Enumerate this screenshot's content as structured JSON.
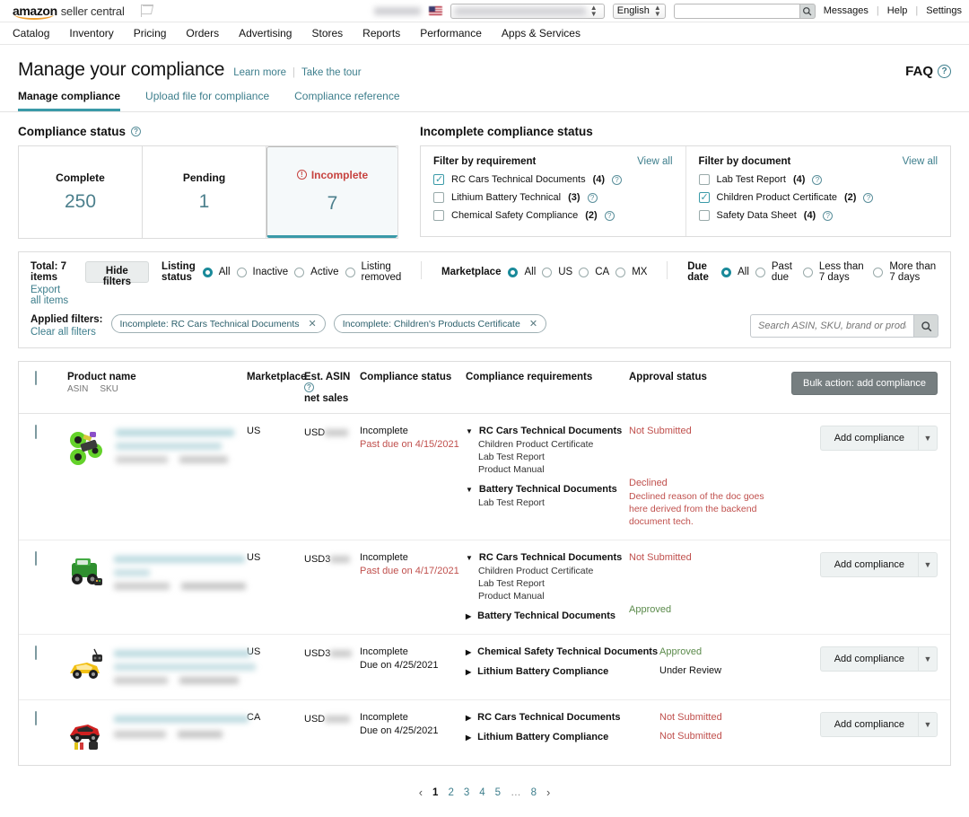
{
  "topnav": {
    "brand_amazon": "amazon",
    "brand_seller_central": "seller central",
    "flag_icon": "flag-icon",
    "language": "English",
    "search_value": "",
    "links": [
      "Messages",
      "Help",
      "Settings"
    ],
    "sep": "|"
  },
  "mainnav": {
    "items": [
      "Catalog",
      "Inventory",
      "Pricing",
      "Orders",
      "Advertising",
      "Stores",
      "Reports",
      "Performance",
      "Apps & Services"
    ]
  },
  "page": {
    "title": "Manage your compliance",
    "learn_more": "Learn more",
    "take_tour": "Take the tour",
    "faq": "FAQ",
    "tabs": [
      {
        "label": "Manage compliance",
        "active": true
      },
      {
        "label": "Upload file for compliance",
        "active": false
      },
      {
        "label": "Compliance reference",
        "active": false
      }
    ]
  },
  "compliance_status": {
    "title": "Compliance status",
    "cards": [
      {
        "label": "Complete",
        "value": "250",
        "selected": false,
        "alert": false
      },
      {
        "label": "Pending",
        "value": "1",
        "selected": false,
        "alert": false
      },
      {
        "label": "Incomplete",
        "value": "7",
        "selected": true,
        "alert": true
      }
    ]
  },
  "incomplete_panel": {
    "title": "Incomplete compliance status",
    "requirement": {
      "title": "Filter by requirement",
      "view_all": "View all",
      "items": [
        {
          "label": "RC Cars Technical Documents",
          "count": "(4)",
          "checked": true
        },
        {
          "label": "Lithium Battery Technical",
          "count": "(3)",
          "checked": false
        },
        {
          "label": "Chemical Safety Compliance",
          "count": "(2)",
          "checked": false
        }
      ]
    },
    "document": {
      "title": "Filter by document",
      "view_all": "View all",
      "items": [
        {
          "label": "Lab Test Report",
          "count": "(4)",
          "checked": false
        },
        {
          "label": "Children Product Certificate",
          "count": "(2)",
          "checked": true
        },
        {
          "label": "Safety Data Sheet",
          "count": "(4)",
          "checked": false
        }
      ]
    }
  },
  "filterbar": {
    "total": "Total: 7 items",
    "export": "Export all items",
    "hide_filters": "Hide filters",
    "listing_status": {
      "label": "Listing status",
      "options": [
        {
          "label": "All",
          "selected": true
        },
        {
          "label": "Inactive",
          "selected": false
        },
        {
          "label": "Active",
          "selected": false
        },
        {
          "label": "Listing removed",
          "selected": false
        }
      ]
    },
    "marketplace": {
      "label": "Marketplace",
      "options": [
        {
          "label": "All",
          "selected": true
        },
        {
          "label": "US",
          "selected": false
        },
        {
          "label": "CA",
          "selected": false
        },
        {
          "label": "MX",
          "selected": false
        }
      ]
    },
    "due_date": {
      "label": "Due date",
      "options": [
        {
          "label": "All",
          "selected": true
        },
        {
          "label": "Past due",
          "selected": false
        },
        {
          "label": "Less than 7 days",
          "selected": false
        },
        {
          "label": "More than 7 days",
          "selected": false
        }
      ]
    },
    "applied_label": "Applied filters:",
    "clear_all": "Clear all filters",
    "applied": [
      "Incomplete: RC Cars Technical Documents",
      "Incomplete: Children's Products Certificate"
    ],
    "search_placeholder": "Search ASIN, SKU, brand or product name",
    "search_value": ""
  },
  "table": {
    "headers": {
      "product_name": "Product name",
      "asin": "ASIN",
      "sku": "SKU",
      "marketplace": "Marketplace",
      "net_sales_l1": "Est. ASIN",
      "net_sales_l2": "net sales",
      "compliance_status": "Compliance status",
      "compliance_requirements": "Compliance requirements",
      "approval_status": "Approval status",
      "bulk_action": "Bulk action: add compliance"
    },
    "add_compliance_label": "Add compliance",
    "rows": [
      {
        "thumb": "rc-monster-truck-green",
        "marketplace": "US",
        "net_sales": "USD",
        "status": "Incomplete",
        "due": "Past due  on 4/15/2021",
        "past_due": true,
        "requirements": [
          {
            "name": "RC Cars Technical Documents",
            "expanded": true,
            "docs": [
              "Children Product Certificate",
              "Lab Test Report",
              "Product Manual"
            ],
            "approval": "Not Submitted",
            "approval_state": "not-sub",
            "reason": ""
          },
          {
            "name": "Battery Technical Documents",
            "expanded": true,
            "docs": [
              "Lab Test Report"
            ],
            "approval": "Declined",
            "approval_state": "declined",
            "reason": "Declined reason of the doc goes here derived from the backend document tech."
          }
        ]
      },
      {
        "thumb": "rc-truck-green",
        "marketplace": "US",
        "net_sales": "USD3",
        "status": "Incomplete",
        "due": "Past due on 4/17/2021",
        "past_due": true,
        "requirements": [
          {
            "name": "RC Cars Technical Documents",
            "expanded": true,
            "docs": [
              "Children Product Certificate",
              "Lab Test Report",
              "Product Manual"
            ],
            "approval": "Not Submitted",
            "approval_state": "not-sub",
            "reason": ""
          },
          {
            "name": "Battery Technical Documents",
            "expanded": false,
            "docs": [],
            "approval": "Approved",
            "approval_state": "approved",
            "reason": ""
          }
        ]
      },
      {
        "thumb": "rc-sportscar-yellow",
        "marketplace": "US",
        "net_sales": "USD3",
        "status": "Incomplete",
        "due": "Due on 4/25/2021",
        "past_due": false,
        "requirements": [
          {
            "name": "Chemical Safety Technical Documents",
            "expanded": false,
            "docs": [],
            "approval": "Approved",
            "approval_state": "approved",
            "reason": ""
          },
          {
            "name": "Lithium Battery Compliance",
            "expanded": false,
            "docs": [],
            "approval": "Under Review",
            "approval_state": "review",
            "reason": ""
          }
        ]
      },
      {
        "thumb": "rc-sportscar-red",
        "marketplace": "CA",
        "net_sales": "USD",
        "status": "Incomplete",
        "due": "Due on 4/25/2021",
        "past_due": false,
        "requirements": [
          {
            "name": "RC Cars Technical Documents",
            "expanded": false,
            "docs": [],
            "approval": "Not Submitted",
            "approval_state": "not-sub",
            "reason": ""
          },
          {
            "name": "Lithium Battery Compliance",
            "expanded": false,
            "docs": [],
            "approval": "Not Submitted",
            "approval_state": "not-sub",
            "reason": ""
          }
        ]
      }
    ]
  },
  "pagination": {
    "prev": "‹",
    "next": "›",
    "pages": [
      "1",
      "2",
      "3",
      "4",
      "5",
      "…",
      "8"
    ],
    "current": "1"
  },
  "colors": {
    "accent_teal": "#3a9aa8",
    "link_teal": "#3d7e8c",
    "error_red": "#c0504d",
    "approved_green": "#5a8a4a"
  }
}
